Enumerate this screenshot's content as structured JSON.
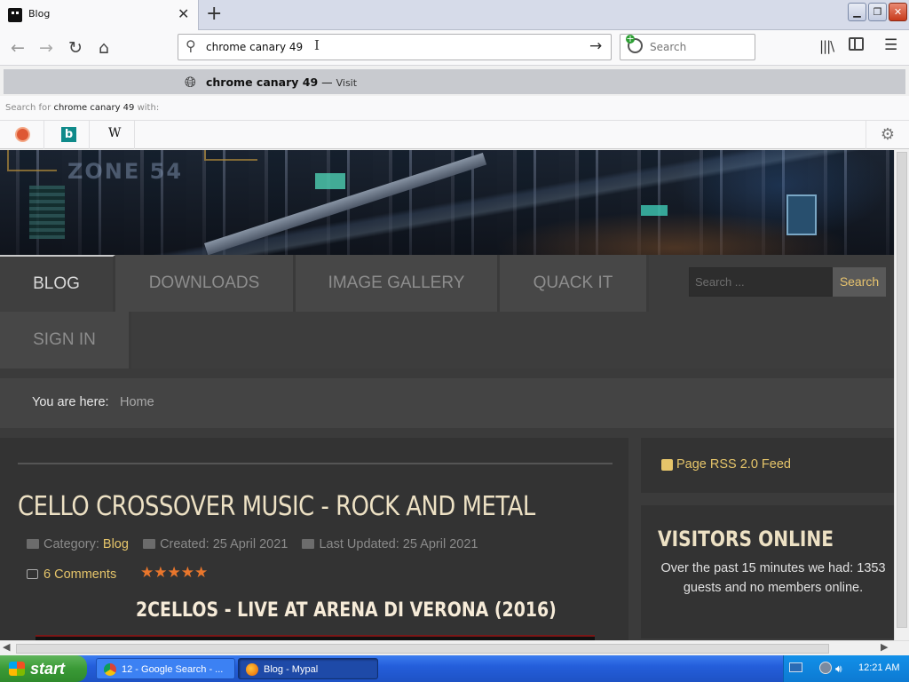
{
  "browser": {
    "tab": {
      "title": "Blog",
      "close_glyph": "✕"
    },
    "new_tab_glyph": "+",
    "window_buttons": {
      "minimize": "▁",
      "restore": "❐",
      "close": "✕"
    },
    "nav": {
      "back": "←",
      "forward": "→",
      "reload": "↻",
      "home": "⌂"
    },
    "url": {
      "value": "chrome canary 49",
      "go": "→"
    },
    "search": {
      "placeholder": "Search"
    },
    "suggestion": {
      "query": "chrome canary 49",
      "separator": " — ",
      "action": "Visit"
    },
    "search_with": {
      "prefix": "Search for ",
      "query": "chrome canary 49",
      "suffix": " with:"
    },
    "engines": [
      {
        "name": "duckduckgo-icon"
      },
      {
        "name": "bing-icon",
        "glyph": "b"
      },
      {
        "name": "wikipedia-icon",
        "glyph": "W"
      }
    ],
    "settings_glyph": "⚙",
    "menu_glyph": "☰",
    "library_glyph": "|||\\"
  },
  "site": {
    "nav_items": [
      "BLOG",
      "DOWNLOADS",
      "IMAGE GALLERY",
      "QUACK IT",
      "SIGN IN"
    ],
    "search": {
      "placeholder": "Search ...",
      "button": "Search"
    },
    "breadcrumb": {
      "label": "You are here:",
      "home": "Home"
    },
    "article": {
      "title": "CELLO CROSSOVER MUSIC - ROCK AND METAL",
      "category_label": "Category:",
      "category": "Blog",
      "created": "Created: 25 April 2021",
      "updated": "Last Updated: 25 April 2021",
      "comments": "6 Comments",
      "rating": 5,
      "rating_max": 5,
      "stars": "★★★★★",
      "video_title": "2CELLOS - LIVE AT ARENA DI VERONA (2016)"
    },
    "sidebar": {
      "rss": "Page RSS 2.0 Feed",
      "visitors_title": "VISITORS ONLINE",
      "visitors_text": "Over the past 15 minutes we had: 1353 guests and no members online."
    }
  },
  "taskbar": {
    "start": "start",
    "tasks": [
      "12 - Google Search - ...",
      "Blog - Mypal"
    ],
    "clock": "12:21 AM"
  },
  "colors": {
    "accent": "#e6c56a",
    "page_bg": "#3b3b3b",
    "taskbar": "#245edb",
    "stars": "#e9762c"
  }
}
